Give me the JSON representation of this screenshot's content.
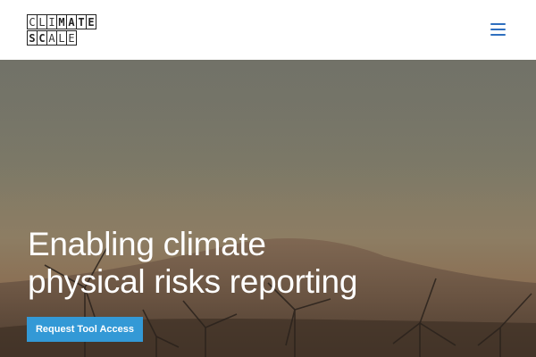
{
  "brand": {
    "logo_row1": [
      "C",
      "L",
      "I",
      "M",
      "A",
      "T",
      "E"
    ],
    "logo_row2": [
      "S",
      "C",
      "A",
      "L",
      "E"
    ],
    "logo_text": "CLIMATE SCALE"
  },
  "header": {
    "menu_icon": "hamburger-menu-icon",
    "accent_color": "#2f6fbf"
  },
  "hero": {
    "title_line1": "Enabling climate",
    "title_line2": "physical risks reporting",
    "cta_label": "Request Tool Access",
    "cta_color": "#3399d6",
    "background": "wind turbines at dusk in hilly landscape"
  }
}
